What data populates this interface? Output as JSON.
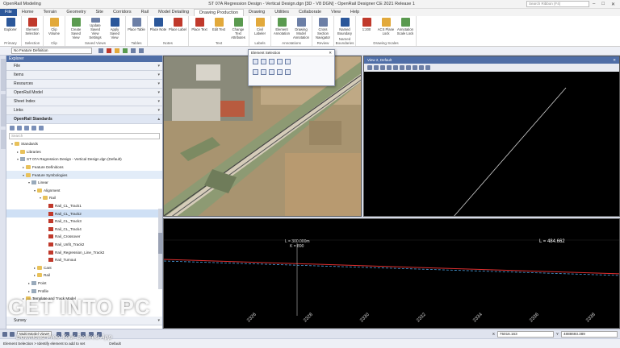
{
  "app": {
    "name": "OpenRail Modeling",
    "title": "ST 07A Regression Design - Vertical Design.dgn [3D - V8 DGN] - OpenRail Designer CE 2021 Release 1",
    "search_placeholder": "Search Ribbon (F4)"
  },
  "ribbon_tabs": [
    "File",
    "Home",
    "Terrain",
    "Geometry",
    "Site",
    "Corridors",
    "Rail",
    "Model Detailing",
    "Drawing Production",
    "Drawing",
    "Utilities",
    "Collaborate",
    "View",
    "Help"
  ],
  "active_tab": "Drawing Production",
  "ribbon_groups": [
    {
      "name": "Primary",
      "buttons": [
        "Explorer"
      ]
    },
    {
      "name": "Selection",
      "buttons": [
        "Element Selection"
      ]
    },
    {
      "name": "Clip",
      "buttons": [
        "Clip Volume"
      ]
    },
    {
      "name": "Saved Views",
      "buttons": [
        "Create Saved View",
        "Update Saved View Settings",
        "Apply Saved View"
      ]
    },
    {
      "name": "Tables",
      "buttons": [
        "Place Table"
      ]
    },
    {
      "name": "Notes",
      "buttons": [
        "Place Note",
        "Place Label"
      ]
    },
    {
      "name": "Text",
      "buttons": [
        "Place Text",
        "Edit Text",
        "Change Text Attributes"
      ]
    },
    {
      "name": "Labels",
      "buttons": [
        "Civil Labeler"
      ]
    },
    {
      "name": "Annotations",
      "buttons": [
        "Element Annotation",
        "Drawing Model Annotation"
      ]
    },
    {
      "name": "Review",
      "buttons": [
        "Cross Section Navigator"
      ]
    },
    {
      "name": "Named Boundaries",
      "buttons": [
        "Named Boundary"
      ]
    },
    {
      "name": "Drawing Scales",
      "buttons": [
        "1:200",
        "ACS Plane Lock",
        "Annotation Scale Lock"
      ]
    }
  ],
  "feature_definition": "No Feature Definition",
  "explorer": {
    "title": "Explorer",
    "sections": [
      "File",
      "Items",
      "Resources",
      "OpenRail Model",
      "Sheet Index",
      "Links",
      "OpenRail Standards"
    ],
    "open_section": "OpenRail Standards",
    "search_placeholder": "Search",
    "tree": [
      {
        "label": "Standards",
        "level": 0,
        "toggle": "▾",
        "icon": "fold"
      },
      {
        "label": "Libraries",
        "level": 1,
        "toggle": "▸",
        "icon": "fold"
      },
      {
        "label": "ST 07A Regression Design - Vertical Design.dgn (Default)",
        "level": 1,
        "toggle": "▾",
        "icon": "doc"
      },
      {
        "label": "Feature Definitions",
        "level": 2,
        "toggle": "▸",
        "icon": "fold"
      },
      {
        "label": "Feature Symbologies",
        "level": 2,
        "toggle": "▾",
        "icon": "fold",
        "state": "hov"
      },
      {
        "label": "Linear",
        "level": 3,
        "toggle": "▾",
        "icon": "doc"
      },
      {
        "label": "Alignment",
        "level": 4,
        "toggle": "▾",
        "icon": "fold"
      },
      {
        "label": "Rail",
        "level": 5,
        "toggle": "▾",
        "icon": "fold"
      },
      {
        "label": "Rail_CL_Track1",
        "level": 6,
        "toggle": "",
        "icon": "rail"
      },
      {
        "label": "Rail_CL_Track2",
        "level": 6,
        "toggle": "",
        "icon": "rail",
        "state": "sel"
      },
      {
        "label": "Rail_CL_Track3",
        "level": 6,
        "toggle": "",
        "icon": "rail"
      },
      {
        "label": "Rail_CL_Track4",
        "level": 6,
        "toggle": "",
        "icon": "rail"
      },
      {
        "label": "Rail_Crossover",
        "level": 6,
        "toggle": "",
        "icon": "rail"
      },
      {
        "label": "Rail_Unfit_Track2",
        "level": 6,
        "toggle": "",
        "icon": "rail"
      },
      {
        "label": "Rail_Regression_Line_Track2",
        "level": 6,
        "toggle": "",
        "icon": "rail"
      },
      {
        "label": "Rail_Turnout",
        "level": 6,
        "toggle": "",
        "icon": "rail"
      },
      {
        "label": "Cant",
        "level": 4,
        "toggle": "▸",
        "icon": "fold"
      },
      {
        "label": "Rail",
        "level": 4,
        "toggle": "▸",
        "icon": "fold"
      },
      {
        "label": "Point",
        "level": 3,
        "toggle": "▸",
        "icon": "doc"
      },
      {
        "label": "Profile",
        "level": 3,
        "toggle": "▸",
        "icon": "doc"
      },
      {
        "label": "Template and Track Model",
        "level": 2,
        "toggle": "▸",
        "icon": "fold"
      }
    ],
    "bottom_section": "Survey"
  },
  "element_selection": {
    "title": "Element Selection"
  },
  "views": {
    "view2_title": "View 2, Default",
    "profile_label_1": "L = 300.000m",
    "profile_label_1b": "K = 890",
    "profile_label_2": "L = 484.662",
    "station_labels": [
      "2326",
      "2328",
      "2330",
      "2332",
      "2334",
      "2336",
      "2338"
    ]
  },
  "statusbar": {
    "model": "Multi-Model Views",
    "x_label": "X",
    "x_value": "75016.163",
    "y_label": "Y",
    "y_value": "4888693.389"
  },
  "footer": {
    "hint": "Element Selection > Identify element to add to set",
    "level": "Default"
  },
  "watermark": {
    "main": "GET INTO PC",
    "sub": "Download Free Your Desired App"
  }
}
